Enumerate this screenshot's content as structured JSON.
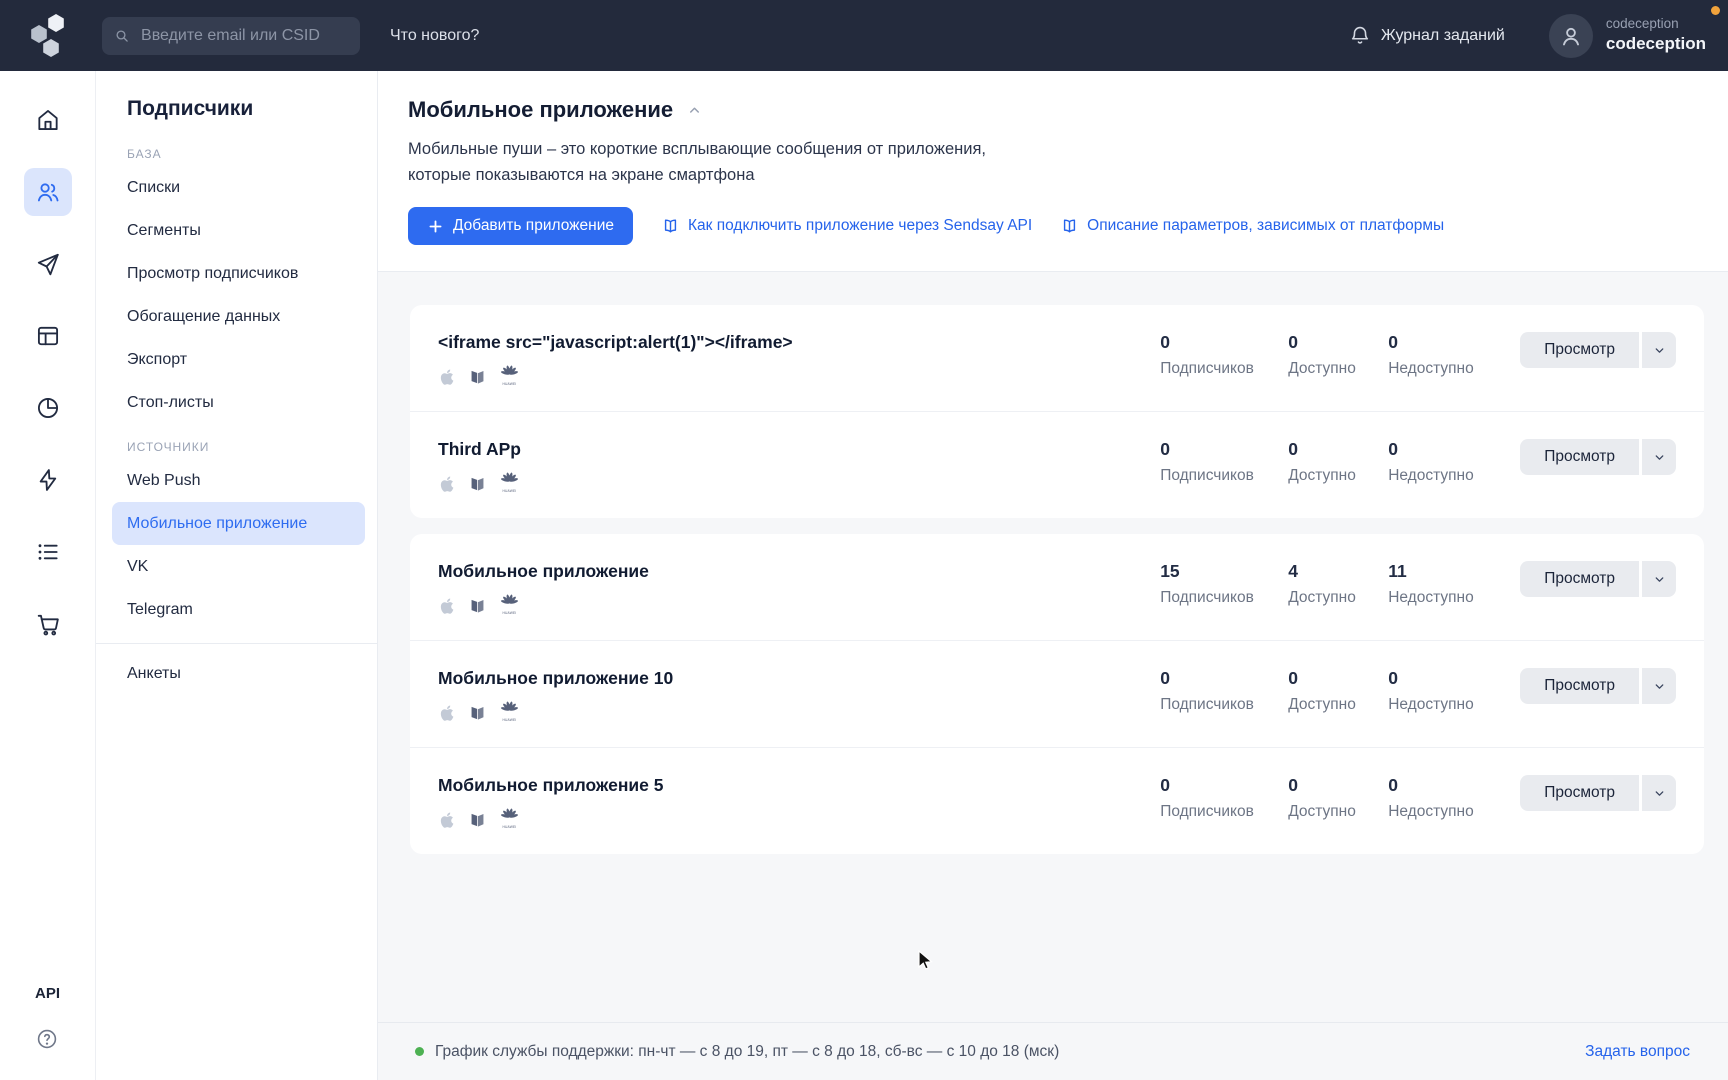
{
  "topbar": {
    "search_placeholder": "Введите email или CSID",
    "whats_new_label": "Что нового?",
    "journal_label": "Журнал заданий",
    "account_org": "codeception",
    "account_name": "codeception"
  },
  "rail": {
    "api_label": "API"
  },
  "sidebar": {
    "title": "Подписчики",
    "active_item": "Мобильное приложение",
    "sections": [
      {
        "label": "БАЗА",
        "items": [
          "Списки",
          "Сегменты",
          "Просмотр подписчиков",
          "Обогащение данных",
          "Экспорт",
          "Стоп-листы"
        ]
      },
      {
        "label": "ИСТОЧНИКИ",
        "items": [
          "Web Push",
          "Мобильное приложение",
          "VK",
          "Telegram"
        ]
      }
    ],
    "bottom_item": "Анкеты"
  },
  "main": {
    "title": "Мобильное приложение",
    "description_lines": [
      "Мобильные пуши – это короткие всплывающие сообщения от приложения,",
      "которые показываются на экране смартфона"
    ],
    "add_app_label": "Добавить приложение",
    "doc_links": [
      "Как подключить приложение через Sendsay API",
      "Описание параметров, зависимых от платформы"
    ],
    "stat_labels": {
      "subscribers": "Подписчиков",
      "available": "Доступно",
      "unavailable": "Недоступно"
    },
    "view_button_label": "Просмотр",
    "platforms": [
      "apple",
      "rustore",
      "huawei"
    ],
    "app_groups": [
      [
        {
          "name": "<iframe src=\"javascript:alert(1)\"></iframe>",
          "subscribers": "0",
          "available": "0",
          "unavailable": "0"
        },
        {
          "name": "Third APp",
          "subscribers": "0",
          "available": "0",
          "unavailable": "0"
        }
      ],
      [
        {
          "name": "Мобильное приложение",
          "subscribers": "15",
          "available": "4",
          "unavailable": "11"
        },
        {
          "name": "Мобильное приложение 10",
          "subscribers": "0",
          "available": "0",
          "unavailable": "0"
        },
        {
          "name": "Мобильное приложение 5",
          "subscribers": "0",
          "available": "0",
          "unavailable": "0"
        }
      ]
    ]
  },
  "footer": {
    "support_schedule": "График службы поддержки: пн-чт — с 8 до 19, пт — с 8 до 18, сб-вс — с 10 до 18 (мск)",
    "ask_question_label": "Задать вопрос"
  }
}
